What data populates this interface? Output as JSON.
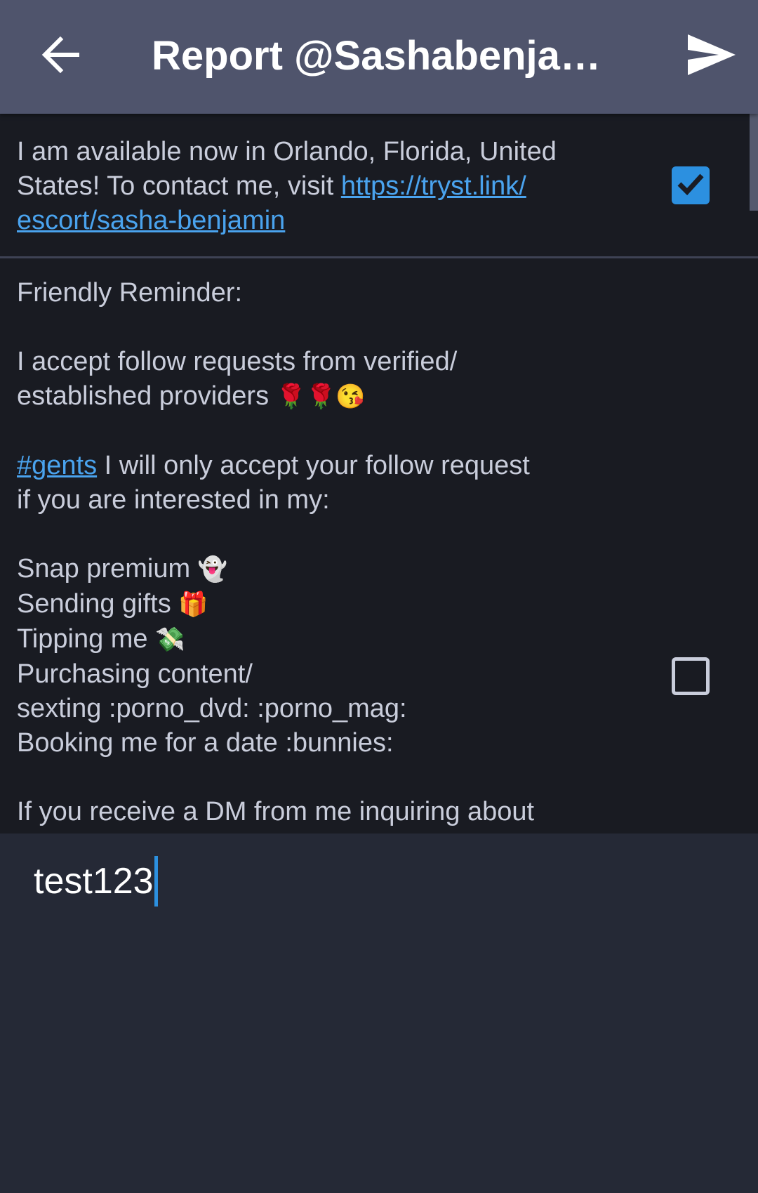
{
  "toolbar": {
    "title": "Report @Sashabenjami…",
    "back_icon": "arrow-left-icon",
    "send_icon": "send-icon"
  },
  "statuses": [
    {
      "checked": true,
      "lines": [
        [
          {
            "text": "I am available now in Orlando, Florida, United"
          }
        ],
        [
          {
            "text": "States! To contact me, visit "
          },
          {
            "text": "https://tryst.link/",
            "link": true
          }
        ],
        [
          {
            "text": "escort/sasha-benjamin",
            "link": true
          }
        ]
      ]
    },
    {
      "checked": false,
      "lines": [
        [
          {
            "text": "Friendly Reminder:"
          }
        ],
        [],
        [
          {
            "text": "I accept follow requests from verified/"
          }
        ],
        [
          {
            "text": "established providers "
          },
          {
            "text": "🌹🌹😘",
            "emoji": true
          }
        ],
        [],
        [
          {
            "text": "#gents",
            "link": true
          },
          {
            "text": " I will only accept your follow request"
          }
        ],
        [
          {
            "text": "if you are interested in my:"
          }
        ],
        [],
        [
          {
            "text": "Snap premium "
          },
          {
            "text": "👻",
            "emoji": true
          }
        ],
        [
          {
            "text": "Sending gifts "
          },
          {
            "text": "🎁",
            "emoji": true
          }
        ],
        [
          {
            "text": "Tipping me "
          },
          {
            "text": "💸",
            "emoji": true
          }
        ],
        [
          {
            "text": "Purchasing content/"
          }
        ],
        [
          {
            "text": "sexting :porno_dvd: :porno_mag:"
          }
        ],
        [
          {
            "text": "Booking me for a date :bunnies:"
          }
        ],
        [],
        [
          {
            "text": "If you receive a DM from me inquiring about"
          }
        ]
      ]
    }
  ],
  "comment": {
    "value": "test123"
  },
  "colors": {
    "toolbar_bg": "#4f546c",
    "list_bg": "#191b22",
    "accent": "#2c90e0",
    "link": "#4aa3ee"
  }
}
